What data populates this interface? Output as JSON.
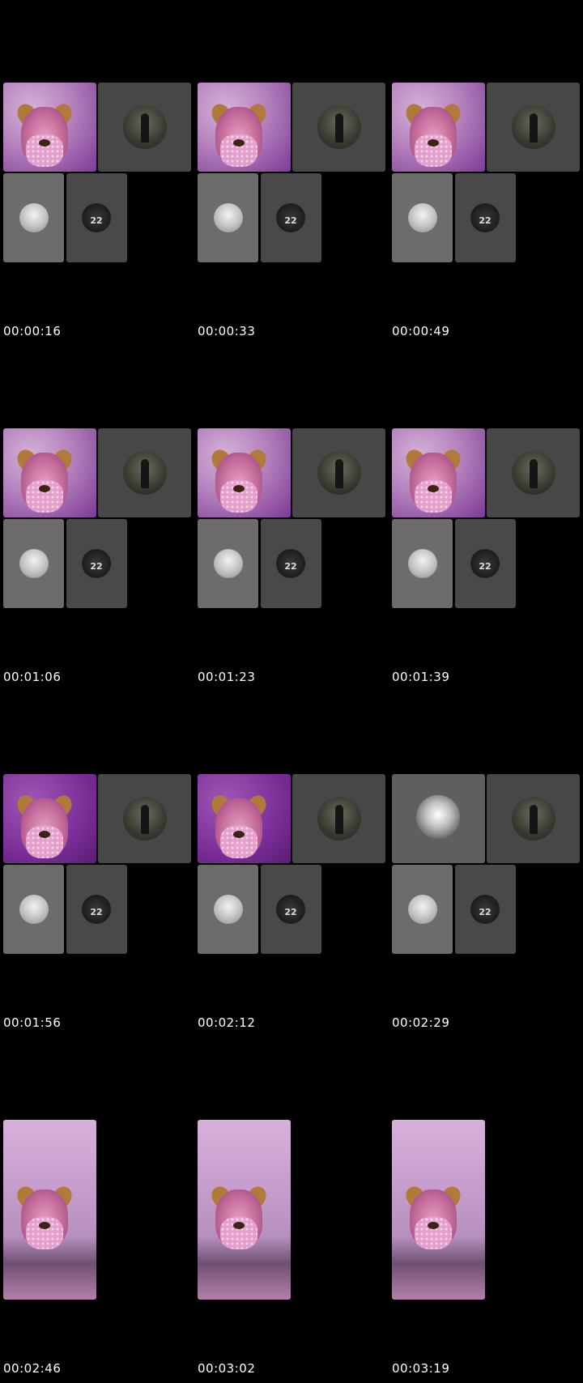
{
  "thumbnails": [
    {
      "timestamp": "00:00:16",
      "layout": "grid",
      "main": "filter"
    },
    {
      "timestamp": "00:00:33",
      "layout": "grid",
      "main": "filter"
    },
    {
      "timestamp": "00:00:49",
      "layout": "grid",
      "main": "filter"
    },
    {
      "timestamp": "00:01:06",
      "layout": "grid",
      "main": "filter"
    },
    {
      "timestamp": "00:01:23",
      "layout": "grid",
      "main": "filter"
    },
    {
      "timestamp": "00:01:39",
      "layout": "grid",
      "main": "filter"
    },
    {
      "timestamp": "00:01:56",
      "layout": "grid",
      "main": "filter-deep"
    },
    {
      "timestamp": "00:02:12",
      "layout": "grid",
      "main": "filter-deep"
    },
    {
      "timestamp": "00:02:29",
      "layout": "grid",
      "main": "avatar"
    },
    {
      "timestamp": "00:02:46",
      "layout": "single",
      "main": "filter"
    },
    {
      "timestamp": "00:03:02",
      "layout": "single",
      "main": "filter"
    },
    {
      "timestamp": "00:03:19",
      "layout": "single",
      "main": "filter"
    }
  ],
  "jersey_number": "22",
  "colors": {
    "background": "#000000",
    "tile_dark": "#474747",
    "tile_light": "#6e6c6a",
    "filter_purple": "#b481bd"
  }
}
